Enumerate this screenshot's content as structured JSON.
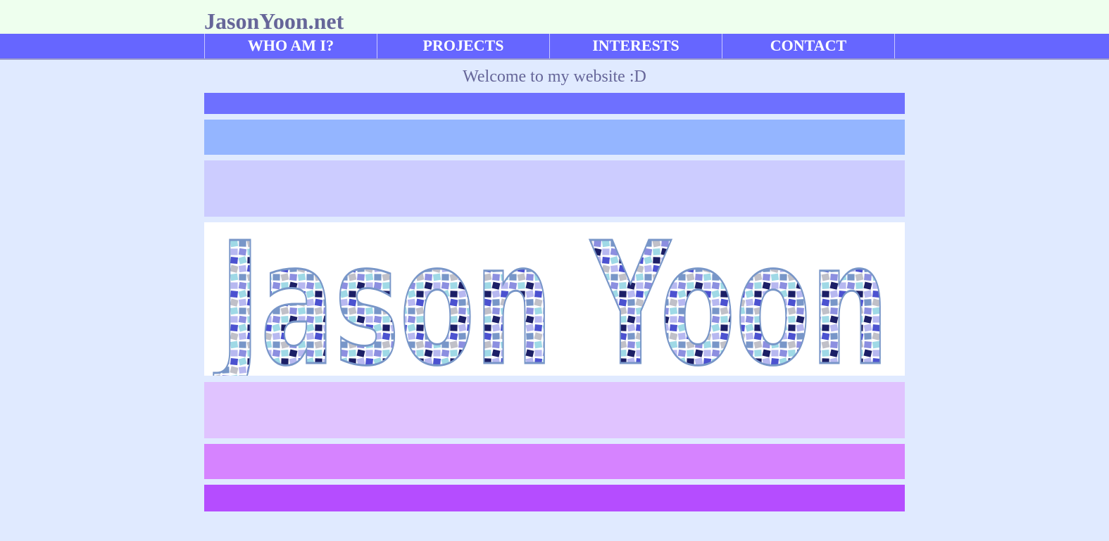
{
  "site": {
    "title": "JasonYoon.net"
  },
  "nav": {
    "items": [
      {
        "label": "WHO AM I?"
      },
      {
        "label": "PROJECTS"
      },
      {
        "label": "INTERESTS"
      },
      {
        "label": "CONTACT"
      }
    ]
  },
  "main": {
    "welcome": "Welcome to my website :D",
    "banner_text": "Jason Yoon"
  },
  "colors": {
    "topbar": "#eeffee",
    "navbar": "#6666ff",
    "page_bg": "#e0eaff",
    "bands": [
      "#6e70ff",
      "#94b5ff",
      "#ccccff",
      "#e0c3ff",
      "#d683ff",
      "#b54dff"
    ],
    "tile_palette": [
      "#9fd9e6",
      "#c0c0c8",
      "#4c52d0",
      "#1c1f66",
      "#8c8fe0",
      "#7896c8",
      "#b7b8f0"
    ]
  }
}
